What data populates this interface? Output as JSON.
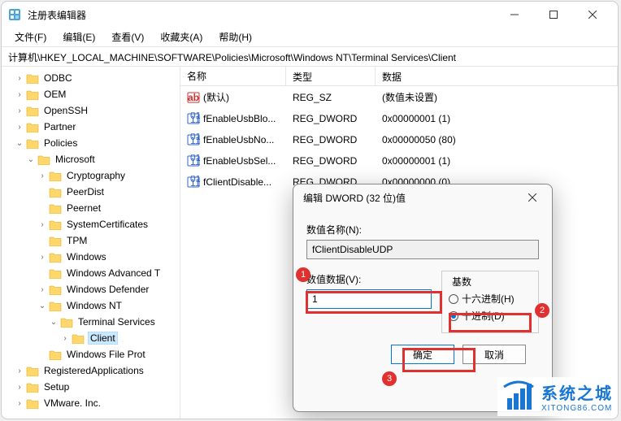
{
  "window": {
    "title": "注册表编辑器"
  },
  "menu": {
    "file": "文件(F)",
    "edit": "编辑(E)",
    "view": "查看(V)",
    "favorites": "收藏夹(A)",
    "help": "帮助(H)"
  },
  "address": "计算机\\HKEY_LOCAL_MACHINE\\SOFTWARE\\Policies\\Microsoft\\Windows NT\\Terminal Services\\Client",
  "tree": {
    "items": [
      {
        "indent": 1,
        "expand": ">",
        "label": "ODBC"
      },
      {
        "indent": 1,
        "expand": ">",
        "label": "OEM"
      },
      {
        "indent": 1,
        "expand": ">",
        "label": "OpenSSH"
      },
      {
        "indent": 1,
        "expand": ">",
        "label": "Partner"
      },
      {
        "indent": 1,
        "expand": "v",
        "label": "Policies"
      },
      {
        "indent": 2,
        "expand": "v",
        "label": "Microsoft"
      },
      {
        "indent": 3,
        "expand": ">",
        "label": "Cryptography"
      },
      {
        "indent": 3,
        "expand": "",
        "label": "PeerDist"
      },
      {
        "indent": 3,
        "expand": "",
        "label": "Peernet"
      },
      {
        "indent": 3,
        "expand": ">",
        "label": "SystemCertificates"
      },
      {
        "indent": 3,
        "expand": "",
        "label": "TPM"
      },
      {
        "indent": 3,
        "expand": ">",
        "label": "Windows"
      },
      {
        "indent": 3,
        "expand": "",
        "label": "Windows Advanced T"
      },
      {
        "indent": 3,
        "expand": ">",
        "label": "Windows Defender"
      },
      {
        "indent": 3,
        "expand": "v",
        "label": "Windows NT"
      },
      {
        "indent": 4,
        "expand": "v",
        "label": "Terminal Services"
      },
      {
        "indent": 5,
        "expand": ">",
        "label": "Client",
        "selected": true
      },
      {
        "indent": 3,
        "expand": "",
        "label": "Windows File Prot"
      },
      {
        "indent": 1,
        "expand": ">",
        "label": "RegisteredApplications"
      },
      {
        "indent": 1,
        "expand": ">",
        "label": "Setup"
      },
      {
        "indent": 1,
        "expand": ">",
        "label": "VMware. Inc."
      }
    ]
  },
  "list": {
    "headers": {
      "name": "名称",
      "type": "类型",
      "data": "数据"
    },
    "rows": [
      {
        "icon": "sz",
        "name": "(默认)",
        "type": "REG_SZ",
        "data": "(数值未设置)"
      },
      {
        "icon": "dw",
        "name": "fEnableUsbBlo...",
        "type": "REG_DWORD",
        "data": "0x00000001 (1)"
      },
      {
        "icon": "dw",
        "name": "fEnableUsbNo...",
        "type": "REG_DWORD",
        "data": "0x00000050 (80)"
      },
      {
        "icon": "dw",
        "name": "fEnableUsbSel...",
        "type": "REG_DWORD",
        "data": "0x00000001 (1)"
      },
      {
        "icon": "dw",
        "name": "fClientDisable...",
        "type": "REG_DWORD",
        "data": "0x00000000 (0)"
      }
    ]
  },
  "dialog": {
    "title": "编辑 DWORD (32 位)值",
    "name_label": "数值名称(N):",
    "name_value": "fClientDisableUDP",
    "data_label": "数值数据(V):",
    "data_value": "1",
    "base_label": "基数",
    "radio_hex": "十六进制(H)",
    "radio_dec": "十进制(D)",
    "ok": "确定",
    "cancel": "取消"
  },
  "annotations": {
    "n1": "1",
    "n2": "2",
    "n3": "3"
  },
  "watermark": {
    "line1": "系统之城",
    "line2": "XITONG86.COM"
  },
  "chart_data": null
}
